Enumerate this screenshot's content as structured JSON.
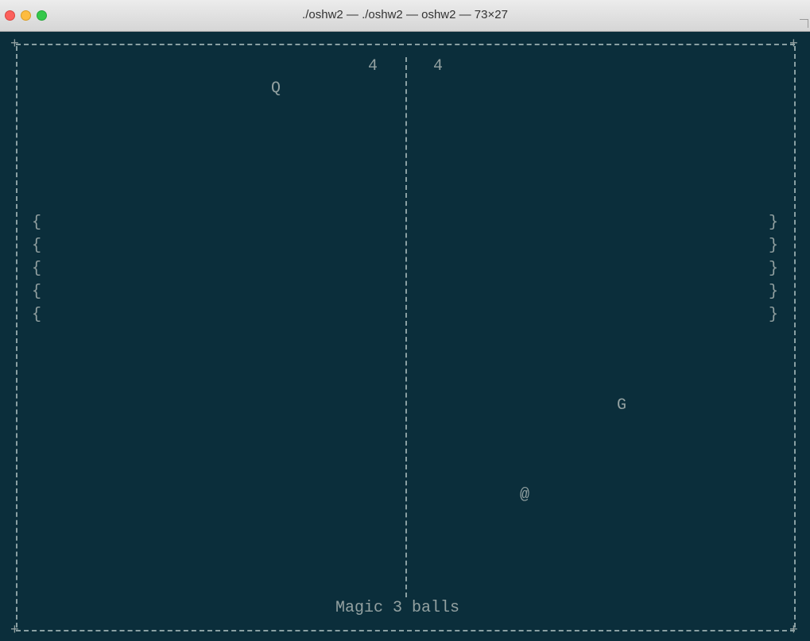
{
  "window": {
    "title": "./oshw2 — ./oshw2 — oshw2 — 73×27"
  },
  "game": {
    "score_left": "4",
    "score_right": "4",
    "ball_q": "Q",
    "ball_g": "G",
    "ball_at": "@",
    "paddle_left": [
      "{",
      "{",
      "{",
      "{",
      "{"
    ],
    "paddle_right": [
      "}",
      "}",
      "}",
      "}",
      "}"
    ],
    "status_text": "Magic 3 balls",
    "border_corner": "+"
  }
}
